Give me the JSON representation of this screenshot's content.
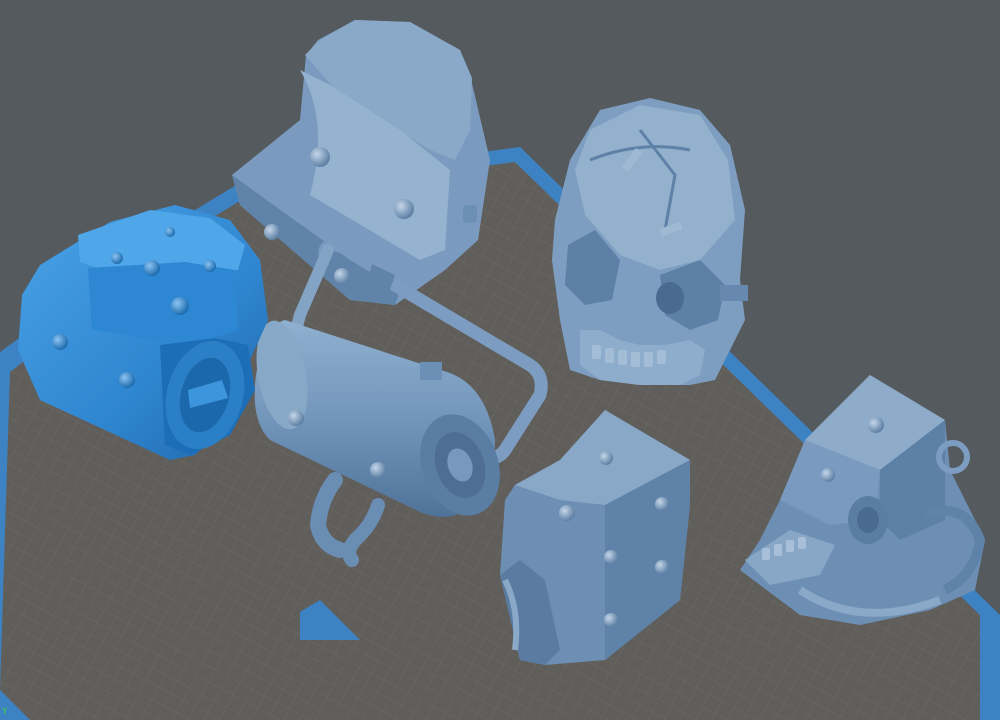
{
  "viewport": {
    "axis_indicator": "Y",
    "background_color": "#555a5e",
    "grid_color": "#6d6a66",
    "plate_border_color": "#3f8ccc",
    "model_color": "#7196bc",
    "selected_model_color": "#2f86d0"
  },
  "models": [
    {
      "name": "cylindrical-armor-piece",
      "selected": true
    },
    {
      "name": "curved-shield-plate",
      "selected": false
    },
    {
      "name": "cylinder-with-handle",
      "selected": false
    },
    {
      "name": "cyber-skull",
      "selected": false
    },
    {
      "name": "mechanical-jaw-block",
      "selected": false
    },
    {
      "name": "tube-head-mechanism",
      "selected": false
    }
  ]
}
